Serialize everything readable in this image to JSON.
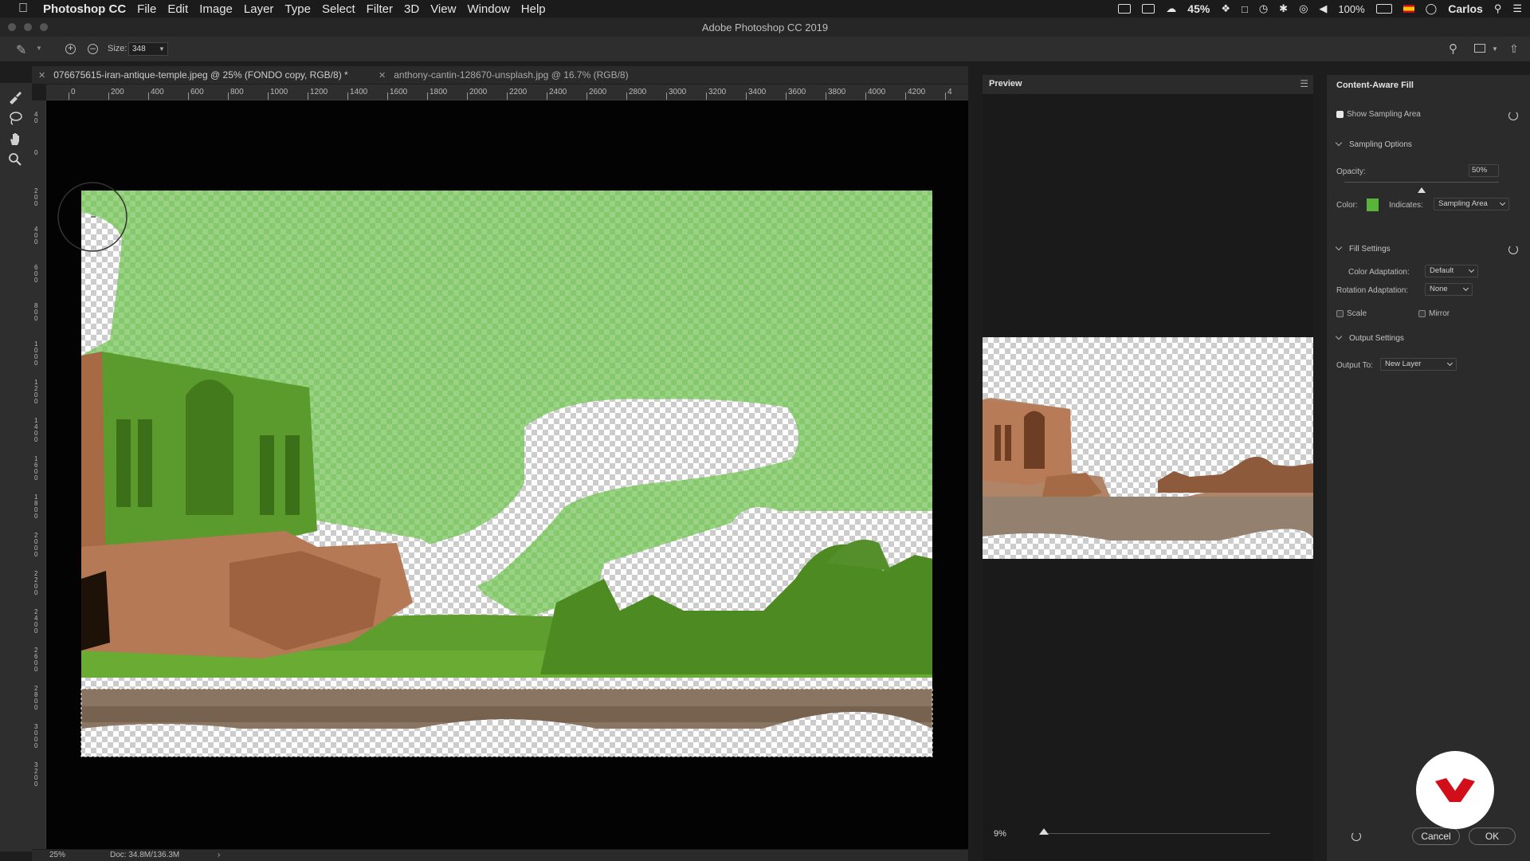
{
  "menubar": {
    "app_name": "Photoshop CC",
    "menus": [
      "File",
      "Edit",
      "Image",
      "Layer",
      "Type",
      "Select",
      "Filter",
      "3D",
      "View",
      "Window",
      "Help"
    ],
    "battery_indicator_pct": "45%",
    "battery_pct": "100%",
    "user": "Carlos"
  },
  "window": {
    "title": "Adobe Photoshop CC 2019"
  },
  "options": {
    "size_label": "Size:",
    "size_value": "348"
  },
  "tabs": [
    {
      "label": "076675615-iran-antique-temple.jpeg @ 25% (FONDO copy, RGB/8) *",
      "active": true
    },
    {
      "label": "anthony-cantin-128670-unsplash.jpg @ 16.7% (RGB/8)",
      "active": false
    }
  ],
  "hruler_ticks": [
    "0",
    "200",
    "400",
    "600",
    "800",
    "1000",
    "1200",
    "1400",
    "1600",
    "1800",
    "2000",
    "2200",
    "2400",
    "2600",
    "2800",
    "3000",
    "3200",
    "3400",
    "3600",
    "3800",
    "4000",
    "4200",
    "4"
  ],
  "vruler_ticks": [
    "4 0",
    "0",
    "2 0 0",
    "4 0 0",
    "6 0 0",
    "8 0 0",
    "1 0 0 0",
    "1 2 0 0",
    "1 4 0 0",
    "1 6 0 0",
    "1 8 0 0",
    "2 0 0 0",
    "2 2 0 0",
    "2 4 0 0",
    "2 6 0 0",
    "2 8 0 0",
    "3 0 0 0",
    "3 2 0 0"
  ],
  "status": {
    "zoom": "25%",
    "doc": "Doc: 34.8M/136.3M"
  },
  "preview": {
    "title": "Preview",
    "zoom": "9%"
  },
  "content_aware": {
    "title": "Content-Aware Fill",
    "show_sampling_area": "Show Sampling Area",
    "sampling_options": "Sampling Options",
    "opacity_label": "Opacity:",
    "opacity_value": "50%",
    "opacity_level": 0.5,
    "color_label": "Color:",
    "color_swatch": "#58b53a",
    "indicates_label": "Indicates:",
    "indicates_value": "Sampling Area",
    "fill_settings": "Fill Settings",
    "color_adaptation_label": "Color Adaptation:",
    "color_adaptation_value": "Default",
    "rotation_adaptation_label": "Rotation Adaptation:",
    "rotation_adaptation_value": "None",
    "scale_label": "Scale",
    "mirror_label": "Mirror",
    "output_settings": "Output Settings",
    "output_to_label": "Output To:",
    "output_to_value": "New Layer",
    "cancel": "Cancel",
    "ok": "OK"
  }
}
